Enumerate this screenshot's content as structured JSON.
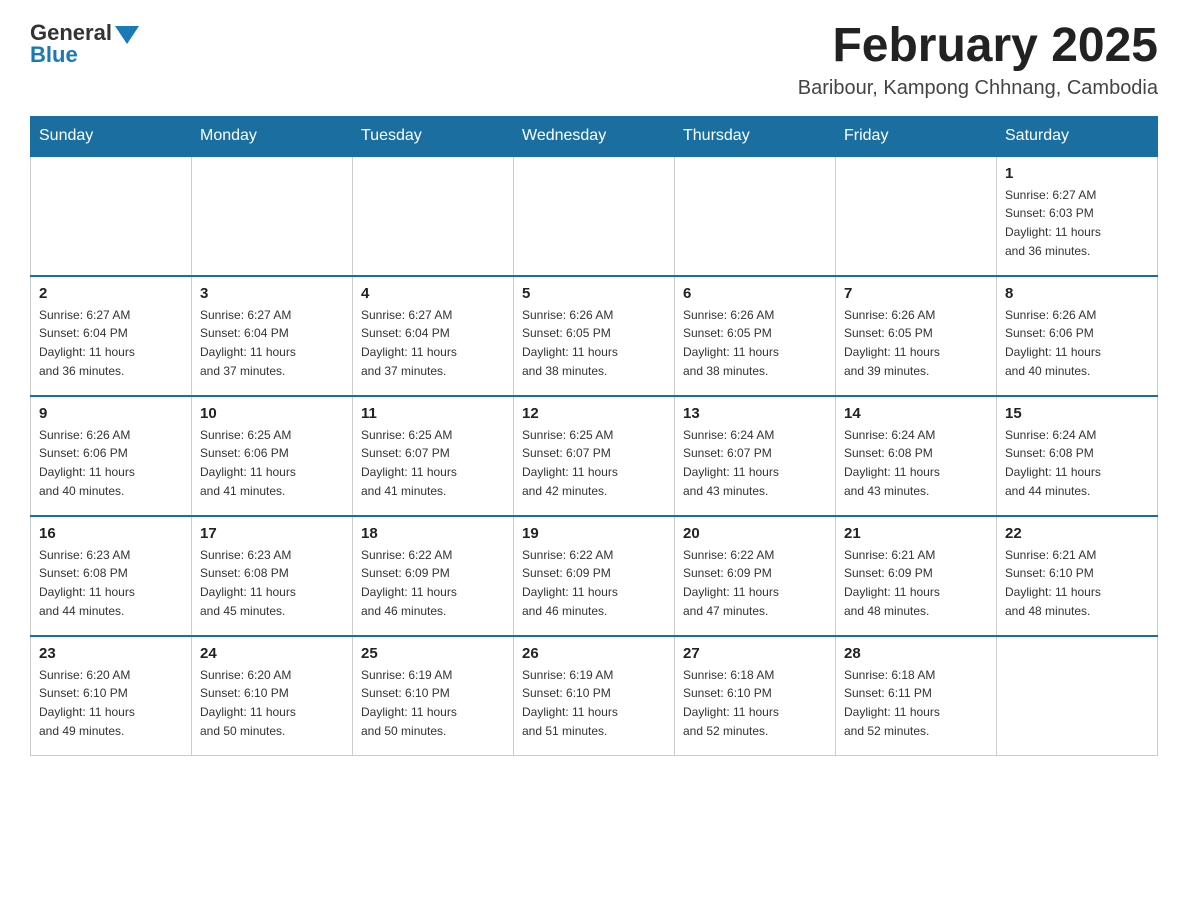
{
  "header": {
    "logo_general": "General",
    "logo_blue": "Blue",
    "month_title": "February 2025",
    "location": "Baribour, Kampong Chhnang, Cambodia"
  },
  "days_of_week": [
    "Sunday",
    "Monday",
    "Tuesday",
    "Wednesday",
    "Thursday",
    "Friday",
    "Saturday"
  ],
  "weeks": [
    [
      {
        "day": "",
        "info": ""
      },
      {
        "day": "",
        "info": ""
      },
      {
        "day": "",
        "info": ""
      },
      {
        "day": "",
        "info": ""
      },
      {
        "day": "",
        "info": ""
      },
      {
        "day": "",
        "info": ""
      },
      {
        "day": "1",
        "info": "Sunrise: 6:27 AM\nSunset: 6:03 PM\nDaylight: 11 hours\nand 36 minutes."
      }
    ],
    [
      {
        "day": "2",
        "info": "Sunrise: 6:27 AM\nSunset: 6:04 PM\nDaylight: 11 hours\nand 36 minutes."
      },
      {
        "day": "3",
        "info": "Sunrise: 6:27 AM\nSunset: 6:04 PM\nDaylight: 11 hours\nand 37 minutes."
      },
      {
        "day": "4",
        "info": "Sunrise: 6:27 AM\nSunset: 6:04 PM\nDaylight: 11 hours\nand 37 minutes."
      },
      {
        "day": "5",
        "info": "Sunrise: 6:26 AM\nSunset: 6:05 PM\nDaylight: 11 hours\nand 38 minutes."
      },
      {
        "day": "6",
        "info": "Sunrise: 6:26 AM\nSunset: 6:05 PM\nDaylight: 11 hours\nand 38 minutes."
      },
      {
        "day": "7",
        "info": "Sunrise: 6:26 AM\nSunset: 6:05 PM\nDaylight: 11 hours\nand 39 minutes."
      },
      {
        "day": "8",
        "info": "Sunrise: 6:26 AM\nSunset: 6:06 PM\nDaylight: 11 hours\nand 40 minutes."
      }
    ],
    [
      {
        "day": "9",
        "info": "Sunrise: 6:26 AM\nSunset: 6:06 PM\nDaylight: 11 hours\nand 40 minutes."
      },
      {
        "day": "10",
        "info": "Sunrise: 6:25 AM\nSunset: 6:06 PM\nDaylight: 11 hours\nand 41 minutes."
      },
      {
        "day": "11",
        "info": "Sunrise: 6:25 AM\nSunset: 6:07 PM\nDaylight: 11 hours\nand 41 minutes."
      },
      {
        "day": "12",
        "info": "Sunrise: 6:25 AM\nSunset: 6:07 PM\nDaylight: 11 hours\nand 42 minutes."
      },
      {
        "day": "13",
        "info": "Sunrise: 6:24 AM\nSunset: 6:07 PM\nDaylight: 11 hours\nand 43 minutes."
      },
      {
        "day": "14",
        "info": "Sunrise: 6:24 AM\nSunset: 6:08 PM\nDaylight: 11 hours\nand 43 minutes."
      },
      {
        "day": "15",
        "info": "Sunrise: 6:24 AM\nSunset: 6:08 PM\nDaylight: 11 hours\nand 44 minutes."
      }
    ],
    [
      {
        "day": "16",
        "info": "Sunrise: 6:23 AM\nSunset: 6:08 PM\nDaylight: 11 hours\nand 44 minutes."
      },
      {
        "day": "17",
        "info": "Sunrise: 6:23 AM\nSunset: 6:08 PM\nDaylight: 11 hours\nand 45 minutes."
      },
      {
        "day": "18",
        "info": "Sunrise: 6:22 AM\nSunset: 6:09 PM\nDaylight: 11 hours\nand 46 minutes."
      },
      {
        "day": "19",
        "info": "Sunrise: 6:22 AM\nSunset: 6:09 PM\nDaylight: 11 hours\nand 46 minutes."
      },
      {
        "day": "20",
        "info": "Sunrise: 6:22 AM\nSunset: 6:09 PM\nDaylight: 11 hours\nand 47 minutes."
      },
      {
        "day": "21",
        "info": "Sunrise: 6:21 AM\nSunset: 6:09 PM\nDaylight: 11 hours\nand 48 minutes."
      },
      {
        "day": "22",
        "info": "Sunrise: 6:21 AM\nSunset: 6:10 PM\nDaylight: 11 hours\nand 48 minutes."
      }
    ],
    [
      {
        "day": "23",
        "info": "Sunrise: 6:20 AM\nSunset: 6:10 PM\nDaylight: 11 hours\nand 49 minutes."
      },
      {
        "day": "24",
        "info": "Sunrise: 6:20 AM\nSunset: 6:10 PM\nDaylight: 11 hours\nand 50 minutes."
      },
      {
        "day": "25",
        "info": "Sunrise: 6:19 AM\nSunset: 6:10 PM\nDaylight: 11 hours\nand 50 minutes."
      },
      {
        "day": "26",
        "info": "Sunrise: 6:19 AM\nSunset: 6:10 PM\nDaylight: 11 hours\nand 51 minutes."
      },
      {
        "day": "27",
        "info": "Sunrise: 6:18 AM\nSunset: 6:10 PM\nDaylight: 11 hours\nand 52 minutes."
      },
      {
        "day": "28",
        "info": "Sunrise: 6:18 AM\nSunset: 6:11 PM\nDaylight: 11 hours\nand 52 minutes."
      },
      {
        "day": "",
        "info": ""
      }
    ]
  ]
}
